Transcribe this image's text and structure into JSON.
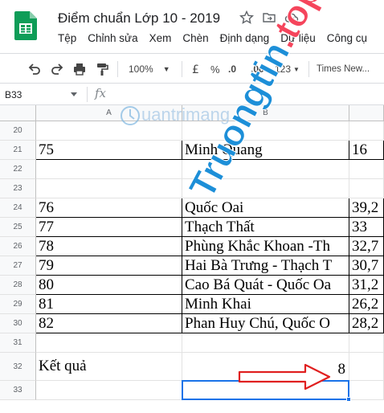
{
  "app": {
    "title": "Điểm chuẩn Lớp 10 - 2019",
    "menu": [
      "Tệp",
      "Chỉnh sửa",
      "Xem",
      "Chèn",
      "Định dạng",
      "Dữ liệu",
      "Công cụ"
    ]
  },
  "toolbar": {
    "zoom": "100%",
    "percent": "%",
    "decrease_decimal": ".0",
    "increase_decimal": ".00",
    "number_format": "123",
    "font": "Times New..."
  },
  "formula_bar": {
    "name_box": "B33",
    "fx_label": "fx"
  },
  "columns": [
    "A",
    "B"
  ],
  "rows": [
    {
      "num": "20",
      "a": "",
      "b": "",
      "c": "",
      "bordered": false
    },
    {
      "num": "21",
      "a": "75",
      "b": "Minh Quang",
      "c": "16",
      "bordered": true
    },
    {
      "num": "22",
      "a": "",
      "b": "",
      "c": "",
      "bordered": false
    },
    {
      "num": "23",
      "a": "",
      "b": "",
      "c": "",
      "bordered": false
    },
    {
      "num": "24",
      "a": "76",
      "b": "Quốc Oai",
      "c": "39,2",
      "bordered": true
    },
    {
      "num": "25",
      "a": "77",
      "b": "Thạch Thất",
      "c": "33",
      "bordered": true
    },
    {
      "num": "26",
      "a": "78",
      "b": "Phùng Khắc Khoan -Th",
      "c": "32,7",
      "bordered": true
    },
    {
      "num": "27",
      "a": "79",
      "b": "Hai Bà Trưng - Thạch T",
      "c": "30,7",
      "bordered": true
    },
    {
      "num": "28",
      "a": "80",
      "b": "Cao Bá Quát - Quốc Oa",
      "c": "31,2",
      "bordered": true
    },
    {
      "num": "29",
      "a": "81",
      "b": "Minh Khai",
      "c": "26,2",
      "bordered": true
    },
    {
      "num": "30",
      "a": "82",
      "b": "Phan Huy Chú, Quốc O",
      "c": "28,2",
      "bordered": true
    },
    {
      "num": "31",
      "a": "",
      "b": "",
      "c": "",
      "bordered": false
    },
    {
      "num": "32",
      "a": "Kết quả",
      "b": "8",
      "c": "",
      "bordered": false
    },
    {
      "num": "33",
      "a": "",
      "b": "",
      "c": "",
      "bordered": false
    }
  ],
  "watermark": {
    "brand": "Truongtin",
    "brand_suffix": ".top",
    "secondary": "uantrimang",
    "color": "#1d8fd8"
  },
  "colors": {
    "selection": "#1a73e8",
    "arrow": "#e02020"
  }
}
